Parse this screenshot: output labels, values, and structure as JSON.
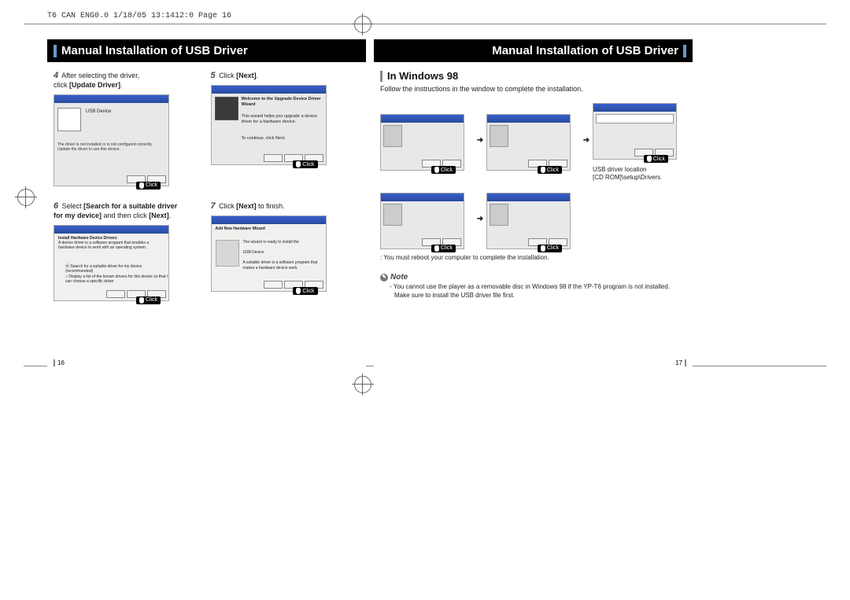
{
  "header": "T6 CAN ENG0.0  1/18/05 13:1412:0  Page 16",
  "left": {
    "title": "Manual Installation of USB Driver",
    "step4": {
      "num": "4",
      "text_a": "After selecting the driver,",
      "text_b": "click [Update Driver]."
    },
    "step5": {
      "num": "5",
      "text": "Click [Next]."
    },
    "step6": {
      "num": "6",
      "text_a": "Select  [Search for a suitable driver",
      "text_b": "for my device] and then click [Next]."
    },
    "step7": {
      "num": "7",
      "text_a": "Click [Next] to finish."
    },
    "page_num": "16",
    "click": "Click"
  },
  "right": {
    "title": "Manual Installation of USB Driver",
    "subheading": "In Windows 98",
    "desc": "Follow the instructions in the window to complete the installation.",
    "loc1": "USB driver location",
    "loc2": "[CD ROM]\\setup\\Drivers",
    "bullet": ": You must reboot your computer to complete the installation.",
    "note_label": "Note",
    "note_l1": "- You cannot use the player as a removable disc in Windows 98 if the YP-T6 program is not installed.",
    "note_l2": "Make sure to install the USB driver file first.",
    "page_num": "17",
    "click": "Click"
  }
}
